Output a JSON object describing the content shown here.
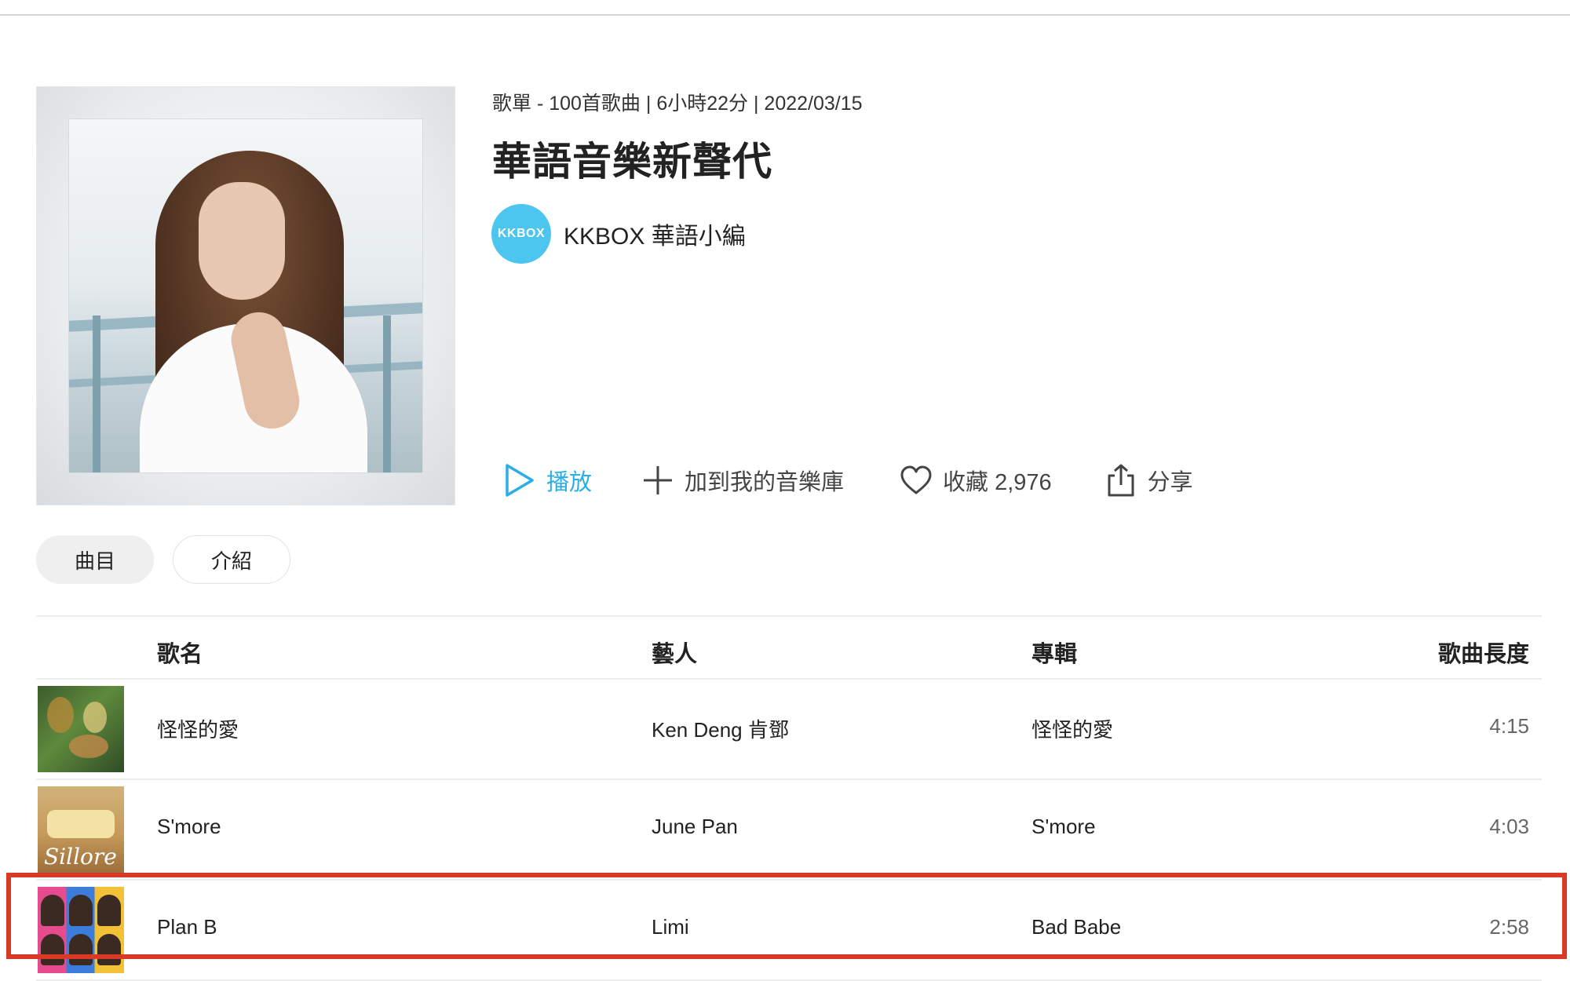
{
  "playlist": {
    "meta": "歌單 - 100首歌曲 | 6小時22分 | 2022/03/15",
    "title": "華語音樂新聲代",
    "curator": {
      "avatar_text": "KKBOX",
      "name": "KKBOX 華語小編",
      "avatar_color": "#4cc6ee"
    }
  },
  "actions": {
    "play_label": "播放",
    "add_label": "加到我的音樂庫",
    "like_label": "收藏 2,976",
    "share_label": "分享",
    "accent_color": "#2aaee6"
  },
  "tabs": {
    "tracks": "曲目",
    "intro": "介紹"
  },
  "table": {
    "headers": {
      "name": "歌名",
      "artist": "藝人",
      "album": "專輯",
      "length": "歌曲長度"
    },
    "rows": [
      {
        "name": "怪怪的愛",
        "artist": "Ken Deng 肯鄧",
        "album": "怪怪的愛",
        "length": "4:15"
      },
      {
        "name": "S'more",
        "artist": "June Pan",
        "album": "S'more",
        "length": "4:03",
        "cover_text": "Sillore"
      },
      {
        "name": "Plan B",
        "artist": "Limi",
        "album": "Bad Babe",
        "length": "2:58"
      }
    ]
  },
  "highlight_color": "#d83a26"
}
